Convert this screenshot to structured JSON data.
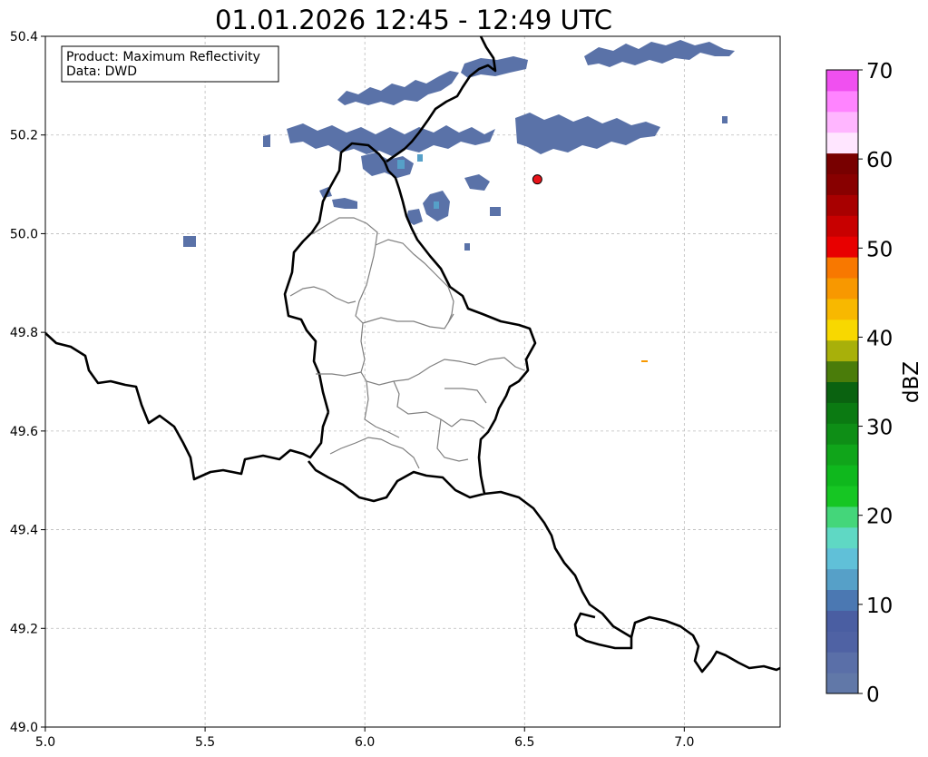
{
  "title": "01.01.2026 12:45 - 12:49 UTC",
  "info_box": {
    "product_line": "Product: Maximum Reflectivity",
    "data_line": "Data: DWD"
  },
  "map": {
    "lon_range": [
      5.0,
      7.3
    ],
    "lat_range": [
      49.0,
      50.4
    ],
    "x_ticks": [
      "5.0",
      "5.5",
      "6.0",
      "6.5",
      "7.0"
    ],
    "y_ticks": [
      "50.4",
      "50.2",
      "50.0",
      "49.8",
      "49.6",
      "49.4",
      "49.2",
      "49.0"
    ],
    "grid": true,
    "marker": {
      "lon": 6.54,
      "lat": 50.11,
      "color": "#e8141a"
    }
  },
  "colorbar": {
    "label": "dBZ",
    "ticks": [
      "70",
      "60",
      "50",
      "40",
      "30",
      "20",
      "10",
      "0"
    ],
    "range": [
      0,
      70
    ],
    "colors": [
      "#6178a8",
      "#5a6fa8",
      "#4f62a4",
      "#4a5ea2",
      "#4b78b2",
      "#56a0c8",
      "#60c0d8",
      "#5fd8c4",
      "#44d67a",
      "#16c623",
      "#0fb81d",
      "#10a51a",
      "#0e8e16",
      "#0b7a12",
      "#0a6210",
      "#4a7c0a",
      "#a8b00a",
      "#f8d800",
      "#f8b800",
      "#f89800",
      "#f87800",
      "#e80000",
      "#c80000",
      "#a80000",
      "#880000",
      "#780000",
      "#ffe6ff",
      "#ffb6ff",
      "#ff84ff",
      "#f050f0"
    ]
  },
  "chart_data": {
    "type": "heatmap",
    "title": "01.01.2026 12:45 - 12:49 UTC",
    "xlim": [
      5.0,
      7.3
    ],
    "ylim": [
      49.0,
      50.4
    ],
    "colorbar_label": "dBZ",
    "colorbar_range": [
      0,
      70
    ],
    "annotations": [
      "Product: Maximum Reflectivity",
      "Data: DWD"
    ]
  }
}
